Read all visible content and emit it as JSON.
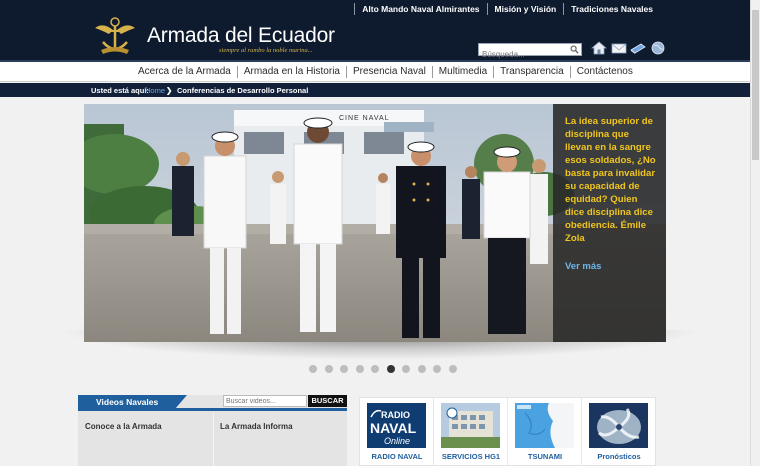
{
  "header": {
    "top_links": [
      "Alto Mando Naval Almirantes",
      "Misión y Visión",
      "Tradiciones Navales"
    ],
    "site_title": "Armada del Ecuador",
    "tagline": "siempre al rumbo la noble marina...",
    "search_placeholder": "Búsqueda..."
  },
  "nav": {
    "items": [
      "Acerca de la Armada",
      "Armada en la Historia",
      "Presencia Naval",
      "Multimedia",
      "Transparencia",
      "Contáctenos"
    ]
  },
  "breadcrumb": {
    "prefix": "Usted está aquí:",
    "home": "Home",
    "current": "Conferencias de Desarrollo Personal"
  },
  "hero": {
    "sign": "CINE NAVAL",
    "quote": "La idea superior de disciplina que llevan en la sangre esos soldados, ¿No basta para invalidar su capacidad de equidad? Quien dice disciplina dice obediencia. Émile Zola",
    "more": "Ver más"
  },
  "slider": {
    "count": 10,
    "active_index": 5
  },
  "videos": {
    "tab": "Videos Navales",
    "search_placeholder": "Buscar videos...",
    "search_button": "BUSCAR",
    "columns": [
      "Conoce a la Armada",
      "La Armada Informa"
    ]
  },
  "services": [
    {
      "label": "RADIO NAVAL",
      "logo_line1": "RADIO",
      "logo_line2": "NAVAL",
      "logo_line3": "Online"
    },
    {
      "label": "SERVICIOS HG1"
    },
    {
      "label": "TSUNAMI"
    },
    {
      "label": "Pronósticos"
    }
  ],
  "colors": {
    "header_bg": "#0e1a2e",
    "accent_blue": "#1f5f9e",
    "quote_yellow": "#f0c61e",
    "link_blue": "#6db6e8"
  }
}
